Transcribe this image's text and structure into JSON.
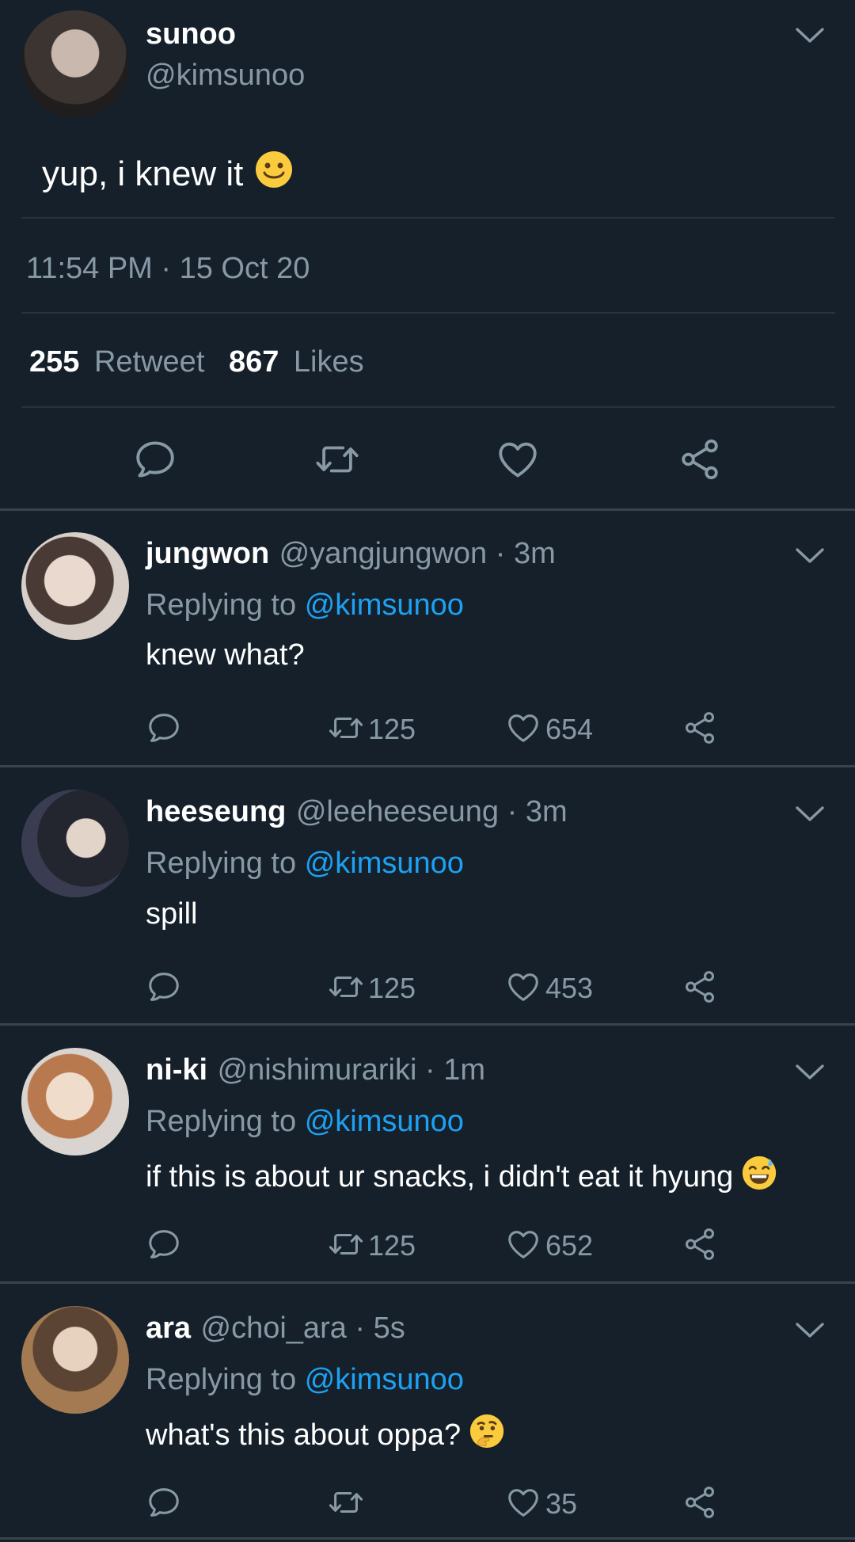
{
  "main_tweet": {
    "name": "sunoo",
    "handle": "@kimsunoo",
    "text": "yup, i knew it",
    "timestamp": "11:54 PM · 15 Oct 20",
    "retweet_count": "255",
    "retweet_label": "Retweet",
    "like_count": "867",
    "like_label": "Likes"
  },
  "replies": [
    {
      "name": "jungwon",
      "meta": "@yangjungwon · 3m",
      "replying_prefix": "Replying to",
      "replying_handle": "@kimsunoo",
      "text": "knew what?",
      "retweets": "125",
      "likes": "654"
    },
    {
      "name": "heeseung",
      "meta": "@leeheeseung · 3m",
      "replying_prefix": "Replying to",
      "replying_handle": "@kimsunoo",
      "text": "spill",
      "retweets": "125",
      "likes": "453"
    },
    {
      "name": "ni-ki",
      "meta": "@nishimurariki · 1m",
      "replying_prefix": "Replying to",
      "replying_handle": "@kimsunoo",
      "text": "if this is about ur snacks, i didn't eat it hyung",
      "retweets": "125",
      "likes": "652"
    },
    {
      "name": "ara",
      "meta": "@choi_ara · 5s",
      "replying_prefix": "Replying to",
      "replying_handle": "@kimsunoo",
      "text": "what's this about oppa?",
      "retweets": "",
      "likes": "35"
    }
  ],
  "icons": {
    "reply": "reply-icon",
    "retweet": "retweet-icon",
    "like": "heart-icon",
    "share": "share-icon",
    "menu": "chevron-down-icon"
  },
  "colors": {
    "background": "#15202b",
    "muted": "#8899a6",
    "link": "#1da1f2",
    "divider": "#38444d"
  }
}
